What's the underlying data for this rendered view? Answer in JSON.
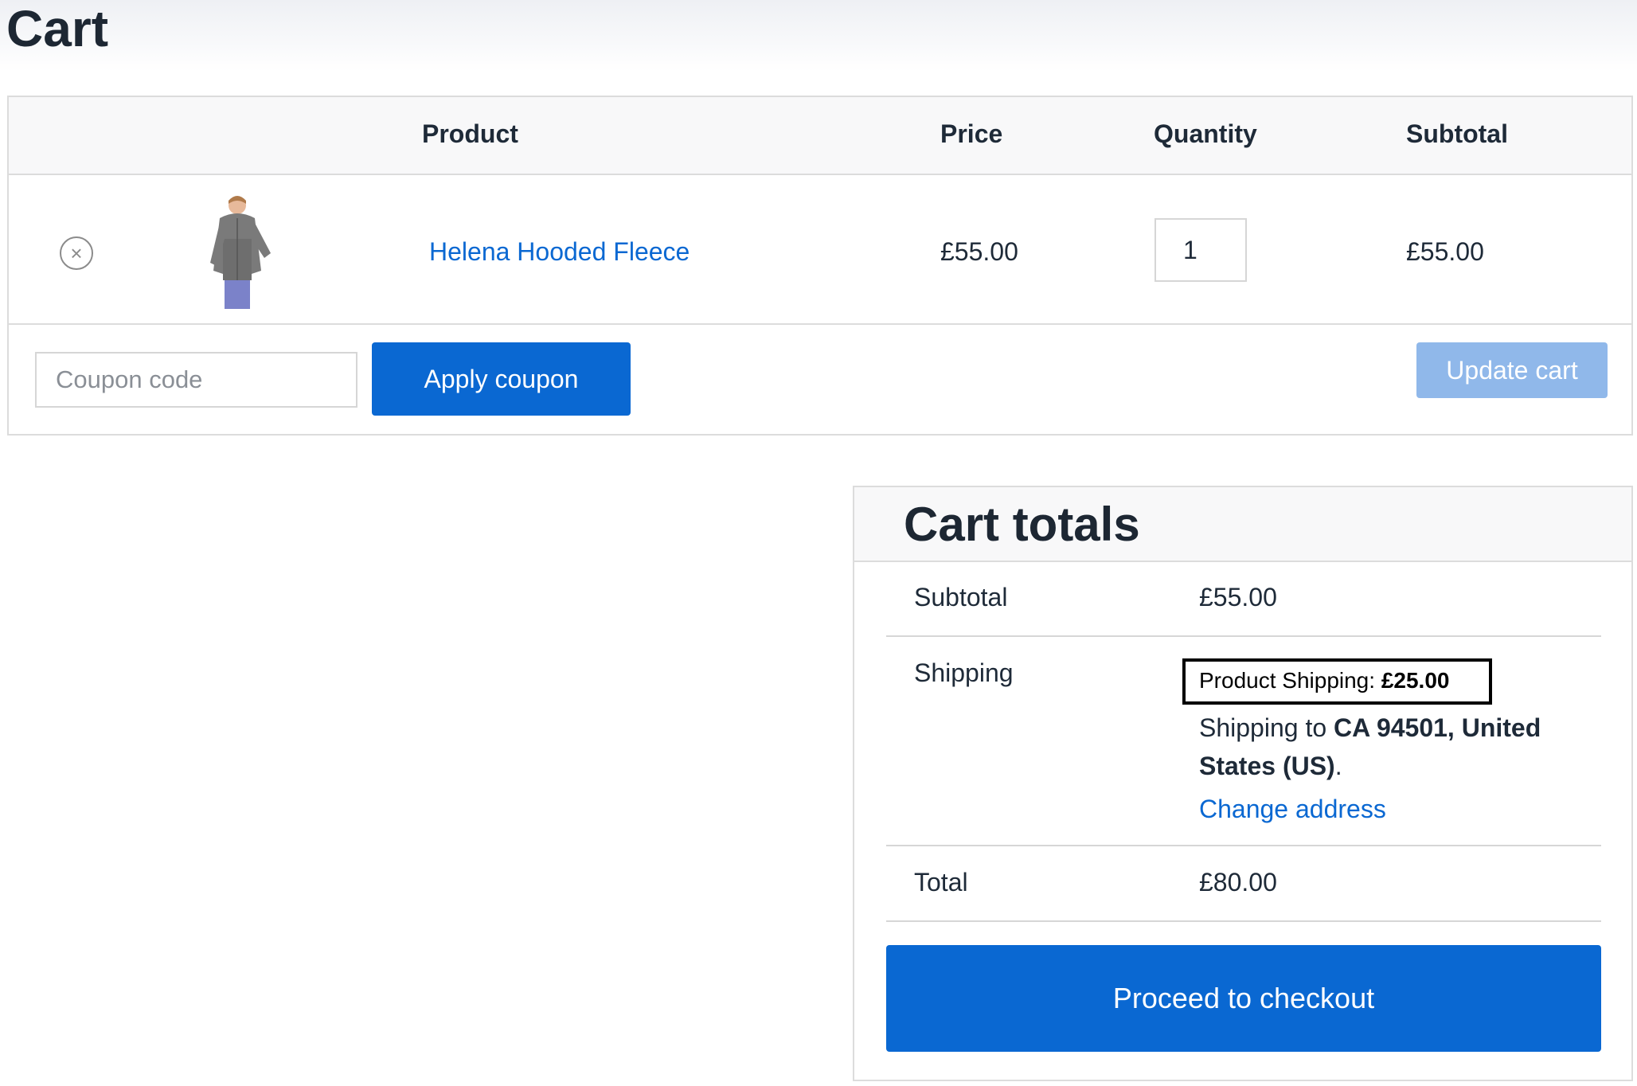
{
  "page": {
    "title": "Cart"
  },
  "cart": {
    "columns": [
      "Product",
      "Price",
      "Quantity",
      "Subtotal"
    ],
    "items": [
      {
        "remove_icon": "close-circle-icon",
        "name": "Helena Hooded Fleece",
        "price": "£55.00",
        "quantity": "1",
        "subtotal": "£55.00"
      }
    ],
    "coupon_placeholder": "Coupon code",
    "apply_label": "Apply coupon",
    "update_label": "Update cart"
  },
  "totals": {
    "title": "Cart totals",
    "subtotal_label": "Subtotal",
    "subtotal_value": "£55.00",
    "shipping_label": "Shipping",
    "shipping_method_label": "Product Shipping:",
    "shipping_method_value": "£25.00",
    "shipping_to_prefix": "Shipping to",
    "shipping_to_address": "CA 94501, United States (US)",
    "shipping_to_suffix": ".",
    "change_address": "Change address",
    "total_label": "Total",
    "total_value": "£80.00",
    "checkout_label": "Proceed to checkout"
  },
  "colors": {
    "accent": "#0a68d2",
    "accent_disabled": "#90b8ea",
    "text": "#1e2a38",
    "border": "#dcdcdc"
  }
}
